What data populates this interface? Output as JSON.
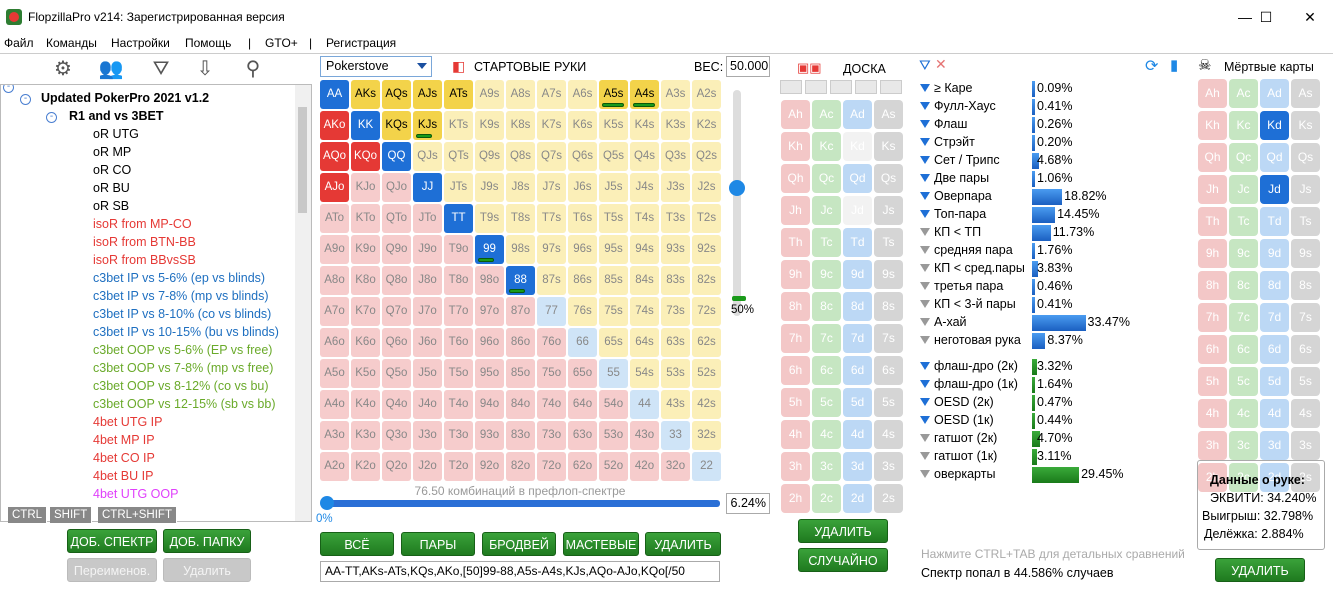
{
  "window": {
    "title": "FlopzillaPro v214: Зарегистрированная версия",
    "minimize": "—",
    "maximize": "☐",
    "close": "✕"
  },
  "menu": [
    "Файл",
    "Команды",
    "Настройки",
    "Помощь",
    "|",
    "GTO+",
    "|",
    "Регистрация"
  ],
  "tree": {
    "root": "Updated PokerPro 2021 v1.2",
    "folder": "R1 and vs 3BET",
    "items": [
      {
        "label": "oR UTG",
        "color": "#000000"
      },
      {
        "label": "oR MP",
        "color": "#000000"
      },
      {
        "label": "oR CO",
        "color": "#000000"
      },
      {
        "label": "oR BU",
        "color": "#000000"
      },
      {
        "label": "oR SB",
        "color": "#000000"
      },
      {
        "label": "isoR from MP-CO",
        "color": "#e53935"
      },
      {
        "label": "isoR from BTN-BB",
        "color": "#e53935"
      },
      {
        "label": "isoR from BBvsSB",
        "color": "#e53935"
      },
      {
        "label": "c3bet IP vs 5-6% (ep vs blinds)",
        "color": "#1e6fc0"
      },
      {
        "label": "c3bet IP vs 7-8% (mp vs blinds)",
        "color": "#1e6fc0"
      },
      {
        "label": "c3bet IP vs 8-10% (co vs blinds)",
        "color": "#1e6fc0"
      },
      {
        "label": "c3bet IP vs 10-15% (bu vs blinds)",
        "color": "#1e6fc0"
      },
      {
        "label": "c3bet OOP vs 5-6% (EP vs free)",
        "color": "#6aaa2a"
      },
      {
        "label": "c3bet OOP vs 7-8% (mp vs free)",
        "color": "#6aaa2a"
      },
      {
        "label": "c3bet OOP vs 8-12% (co vs bu)",
        "color": "#6aaa2a"
      },
      {
        "label": "c3bet OOP vs 12-15% (sb vs bb)",
        "color": "#6aaa2a"
      },
      {
        "label": "4bet UTG IP",
        "color": "#e53935"
      },
      {
        "label": "4bet MP IP",
        "color": "#e53935"
      },
      {
        "label": "4bet CO IP",
        "color": "#e53935"
      },
      {
        "label": "4bet BU IP",
        "color": "#e53935"
      },
      {
        "label": "4bet UTG OOP",
        "color": "#e040fb"
      }
    ]
  },
  "kbd_tabs": [
    "CTRL",
    "SHIFT",
    "CTRL+SHIFT"
  ],
  "left_buttons": {
    "add_range": "ДОБ. СПЕКТР",
    "add_folder": "ДОБ. ПАПКУ",
    "rename": "Переименов.",
    "delete": "Удалить"
  },
  "range": {
    "preset": "Pokerstove",
    "title": "СТАРТОВЫЕ РУКИ",
    "weight_label": "ВЕС:",
    "weight_value": "50.000",
    "combos": "76.50 комбинаций в префлоп-спектре",
    "pct0": "0%",
    "pct50": "50%",
    "pct": "6.24%",
    "range_string": "AA-TT,AKs-ATs,KQs,AKo,[50]99-88,A5s-A4s,KJs,AQo-AJo,KQo[/50"
  },
  "range_buttons": [
    "ВСЁ",
    "ПАРЫ",
    "БРОДВЕЙ",
    "МАСТЕВЫЕ",
    "УДАЛИТЬ"
  ],
  "board": {
    "label": "ДОСКА",
    "delete": "УДАЛИТЬ",
    "random": "СЛУЧАЙНО"
  },
  "stats": [
    {
      "label": "≥ Каре",
      "value": "0.09%",
      "pct": 0.09,
      "active": true
    },
    {
      "label": "Фулл-Хаус",
      "value": "0.41%",
      "pct": 0.41,
      "active": true
    },
    {
      "label": "Флаш",
      "value": "0.26%",
      "pct": 0.26,
      "active": true
    },
    {
      "label": "Стрэйт",
      "value": "0.20%",
      "pct": 0.2,
      "active": true
    },
    {
      "label": "Сет / Трипс",
      "value": "4.68%",
      "pct": 4.68,
      "active": true
    },
    {
      "label": "Две пары",
      "value": "1.06%",
      "pct": 1.06,
      "active": true
    },
    {
      "label": "Оверпара",
      "value": "18.82%",
      "pct": 18.82,
      "active": true
    },
    {
      "label": "Топ-пара",
      "value": "14.45%",
      "pct": 14.45,
      "active": true
    },
    {
      "label": "КП < ТП",
      "value": "11.73%",
      "pct": 11.73,
      "active": false
    },
    {
      "label": "средняя пара",
      "value": "1.76%",
      "pct": 1.76,
      "active": false
    },
    {
      "label": "КП < сред.пары",
      "value": "3.83%",
      "pct": 3.83,
      "active": false
    },
    {
      "label": "третья пара",
      "value": "0.46%",
      "pct": 0.46,
      "active": false
    },
    {
      "label": "КП < 3-й пары",
      "value": "0.41%",
      "pct": 0.41,
      "active": false
    },
    {
      "label": "А-хай",
      "value": "33.47%",
      "pct": 33.47,
      "active": false
    },
    {
      "label": "неготовая рука",
      "value": "8.37%",
      "pct": 8.37,
      "active": false
    }
  ],
  "draws": [
    {
      "label": "флаш-дро (2к)",
      "value": "3.32%",
      "pct": 3.32,
      "active": true
    },
    {
      "label": "флаш-дро (1к)",
      "value": "1.64%",
      "pct": 1.64,
      "active": true
    },
    {
      "label": "OESD (2к)",
      "value": "0.47%",
      "pct": 0.47,
      "active": true
    },
    {
      "label": "OESD (1к)",
      "value": "0.44%",
      "pct": 0.44,
      "active": true
    },
    {
      "label": "гатшот (2к)",
      "value": "4.70%",
      "pct": 4.7,
      "active": false
    },
    {
      "label": "гатшот (1к)",
      "value": "3.11%",
      "pct": 3.11,
      "active": false
    },
    {
      "label": "оверкарты",
      "value": "29.45%",
      "pct": 29.45,
      "active": false
    }
  ],
  "hint": "Нажмите CTRL+TAB для детальных сравнений",
  "hit": "Спектр попал в 44.586% случаев",
  "dead": {
    "label": "Мёртвые карты",
    "delete": "УДАЛИТЬ"
  },
  "hand_data": {
    "title": "Данные о руке:",
    "equity": "ЭКВИТИ: 34.240%",
    "win": "Выигрыш: 32.798%",
    "tie": "Делёжка: 2.884%"
  },
  "colors": {
    "selected_pair": "#1e6fd6",
    "selected_suited": "#f3d34a",
    "selected_offsuit": "#e53935",
    "pair": "#cfe4f7",
    "suited": "#fbefb8",
    "offsuit": "#f6cccc",
    "hearts": "#f3c7c7",
    "clubs": "#c6e6c2",
    "diamonds": "#bcd8f5",
    "spades": "#d5d5d5"
  }
}
